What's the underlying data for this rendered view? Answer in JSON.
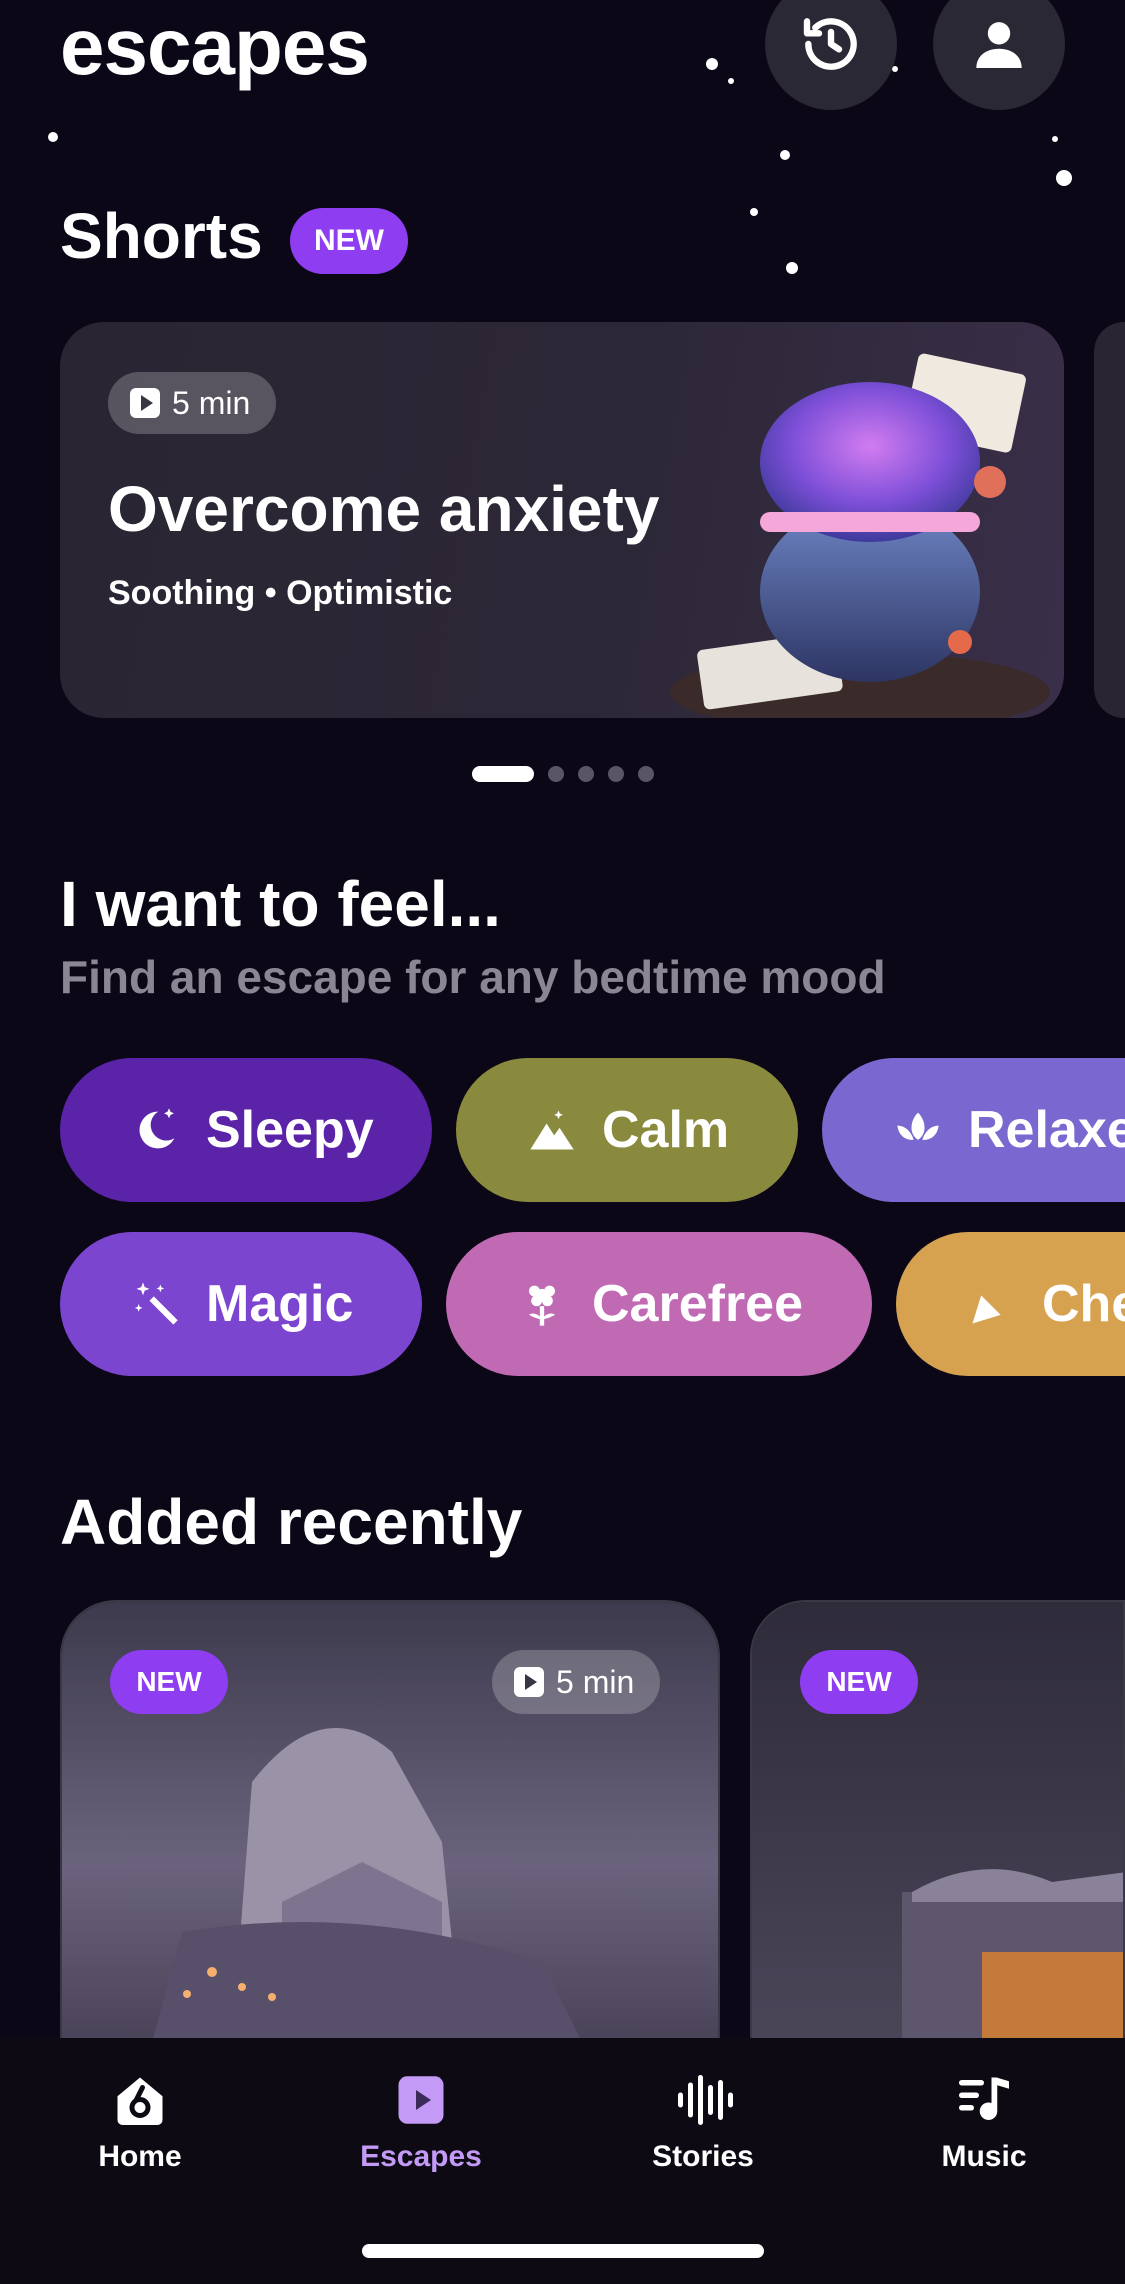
{
  "header": {
    "app_title": "escapes",
    "history_icon": "history-icon",
    "profile_icon": "profile-icon"
  },
  "shorts": {
    "title": "Shorts",
    "badge": "NEW",
    "card": {
      "duration": "5 min",
      "title": "Overcome anxiety",
      "subtitle": "Soothing • Optimistic"
    },
    "pagination": {
      "total": 5,
      "active": 1
    }
  },
  "feel": {
    "title": "I want to feel...",
    "subtitle": "Find an escape for any bedtime mood",
    "moods": [
      {
        "label": "Sleepy",
        "icon": "moon-stars-icon",
        "color": "#5a23a8"
      },
      {
        "label": "Calm",
        "icon": "mountain-icon",
        "color": "#8a8a3e"
      },
      {
        "label": "Relaxe",
        "icon": "lotus-icon",
        "color": "#7a68d0"
      },
      {
        "label": "Magic",
        "icon": "magic-wand-icon",
        "color": "#7b45cf"
      },
      {
        "label": "Carefree",
        "icon": "flower-icon",
        "color": "#c06ab4"
      },
      {
        "label": "Che",
        "icon": "party-popper-icon",
        "color": "#d7a24f"
      }
    ]
  },
  "recent": {
    "title": "Added recently",
    "cards": [
      {
        "badge": "NEW",
        "duration": "5 min"
      },
      {
        "badge": "NEW"
      }
    ]
  },
  "tabbar": {
    "items": [
      {
        "label": "Home",
        "icon": "home-icon",
        "active": false
      },
      {
        "label": "Escapes",
        "icon": "play-square-icon",
        "active": true
      },
      {
        "label": "Stories",
        "icon": "waveform-icon",
        "active": false
      },
      {
        "label": "Music",
        "icon": "music-note-icon",
        "active": false
      }
    ],
    "active_color": "#c39af5"
  }
}
